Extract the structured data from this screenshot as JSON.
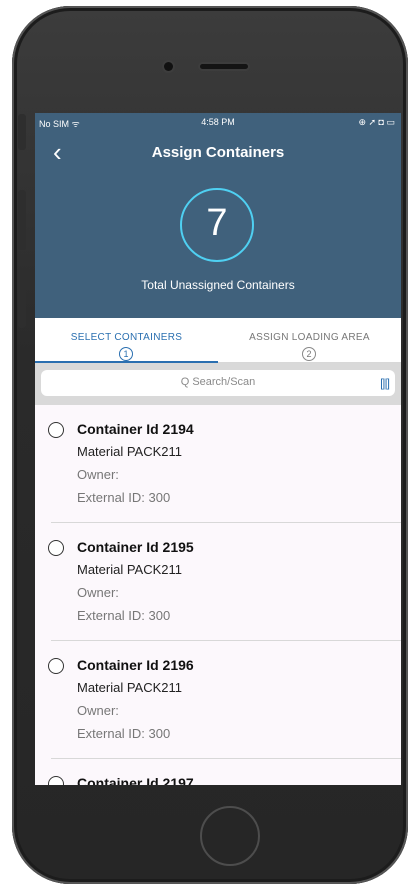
{
  "status_bar": {
    "carrier": "No SIM ᯤ",
    "time": "4:58 PM",
    "indicators": "⊕ ➚ ◘ ▭"
  },
  "nav": {
    "back_label": "‹",
    "title": "Assign Containers"
  },
  "summary": {
    "count": "7",
    "label": "Total Unassigned Containers"
  },
  "tabs": [
    {
      "label": "SELECT CONTAINERS",
      "step": "1",
      "active": true
    },
    {
      "label": "ASSIGN LOADING AREA",
      "step": "2",
      "active": false
    }
  ],
  "search": {
    "placeholder": "Q Search/Scan",
    "scan_icon": "barcode-icon",
    "scan_glyph": "[||]"
  },
  "containers": [
    {
      "title": "Container Id 2194",
      "material": "Material PACK211",
      "owner": "Owner:",
      "external": "External ID: 300"
    },
    {
      "title": "Container Id 2195",
      "material": "Material PACK211",
      "owner": "Owner:",
      "external": "External ID: 300"
    },
    {
      "title": "Container Id 2196",
      "material": "Material PACK211",
      "owner": "Owner:",
      "external": "External ID: 300"
    },
    {
      "title": "Container Id 2197",
      "material": "",
      "owner": "",
      "external": ""
    }
  ],
  "colors": {
    "header_bg": "#40617c",
    "accent": "#2a6fb0",
    "circle": "#4fd0f2",
    "list_bg": "#fcf8fc"
  }
}
